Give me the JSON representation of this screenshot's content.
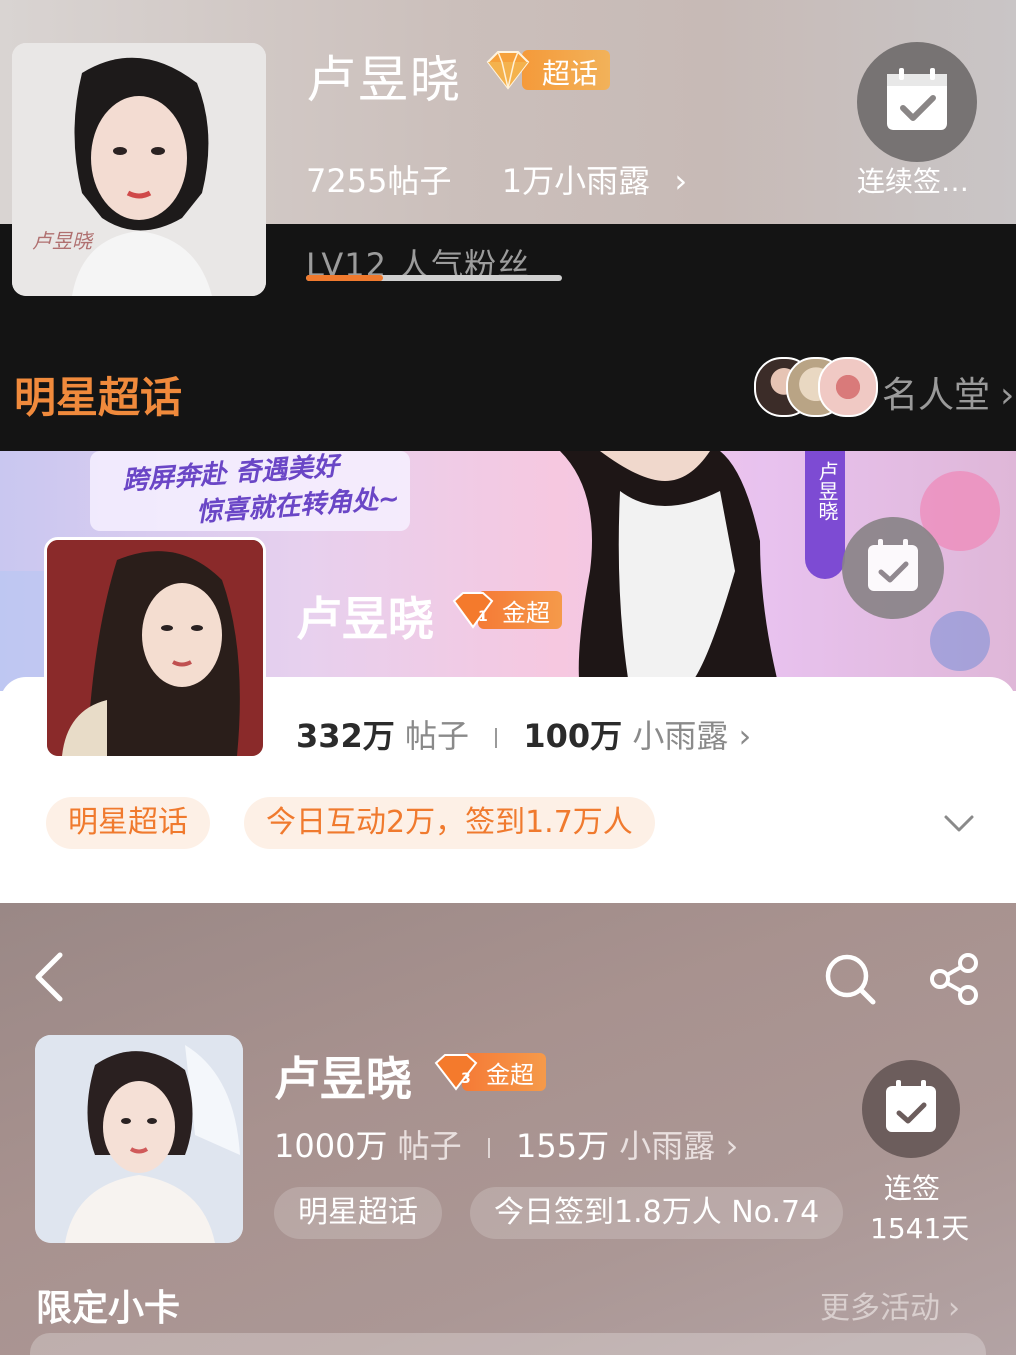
{
  "panel1": {
    "name": "卢昱晓",
    "badge": "超话",
    "posts": "7255帖子",
    "dew": "1万小雨露",
    "level": "LV12 人气粉丝",
    "level_progress": 0.3,
    "checkin_label": "连续签…",
    "category": "明星超话",
    "fame_label": "名人堂"
  },
  "panel2": {
    "banner_line1": "跨屏奔赴 奇遇美好",
    "banner_line2": "惊喜就在转角处~",
    "vertical_tag": "卢昱晓",
    "name": "卢昱晓",
    "badge": "金超",
    "posts_num": "332万",
    "posts_unit": "帖子",
    "dew_num": "100万",
    "dew_unit": "小雨露",
    "tag_category": "明星超话",
    "tag_today": "今日互动2万，签到1.7万人"
  },
  "panel3": {
    "name": "卢昱晓",
    "badge": "金超",
    "posts_num": "1000万",
    "posts_unit": "帖子",
    "dew_num": "155万",
    "dew_unit": "小雨露",
    "tag_category": "明星超话",
    "tag_today": "今日签到1.8万人 No.74",
    "checkin_line1": "连签",
    "checkin_line2": "1541天",
    "section_title": "限定小卡",
    "more_label": "更多活动"
  },
  "colors": {
    "accent_orange": "#f07a2e",
    "badge_orange": "#f59a3a",
    "panel1_dark": "#141414",
    "panel3_bg": "#a8928f"
  },
  "icons": [
    "diamond-icon",
    "calendar-check-icon",
    "chevron-right-icon",
    "chevron-down-icon",
    "back-arrow-icon",
    "search-icon",
    "share-icon"
  ]
}
